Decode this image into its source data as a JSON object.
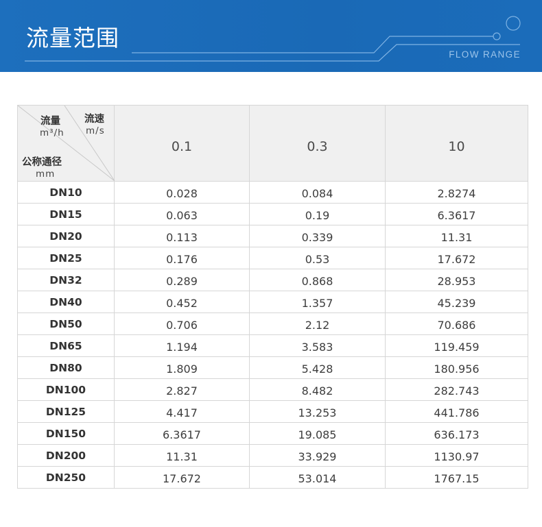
{
  "banner": {
    "title": "流量范围",
    "subtitle": "FLOW RANGE"
  },
  "table": {
    "corner": {
      "flow_label": "流量",
      "flow_unit": "m³/h",
      "velocity_label": "流速",
      "velocity_unit": "m/s",
      "diameter_label": "公称通径",
      "diameter_unit": "mm"
    },
    "velocities": [
      "0.1",
      "0.3",
      "10"
    ],
    "rows": [
      {
        "dn": "DN10",
        "values": [
          "0.028",
          "0.084",
          "2.8274"
        ]
      },
      {
        "dn": "DN15",
        "values": [
          "0.063",
          "0.19",
          "6.3617"
        ]
      },
      {
        "dn": "DN20",
        "values": [
          "0.113",
          "0.339",
          "11.31"
        ]
      },
      {
        "dn": "DN25",
        "values": [
          "0.176",
          "0.53",
          "17.672"
        ]
      },
      {
        "dn": "DN32",
        "values": [
          "0.289",
          "0.868",
          "28.953"
        ]
      },
      {
        "dn": "DN40",
        "values": [
          "0.452",
          "1.357",
          "45.239"
        ]
      },
      {
        "dn": "DN50",
        "values": [
          "0.706",
          "2.12",
          "70.686"
        ]
      },
      {
        "dn": "DN65",
        "values": [
          "1.194",
          "3.583",
          "119.459"
        ]
      },
      {
        "dn": "DN80",
        "values": [
          "1.809",
          "5.428",
          "180.956"
        ]
      },
      {
        "dn": "DN100",
        "values": [
          "2.827",
          "8.482",
          "282.743"
        ]
      },
      {
        "dn": "DN125",
        "values": [
          "4.417",
          "13.253",
          "441.786"
        ]
      },
      {
        "dn": "DN150",
        "values": [
          "6.3617",
          "19.085",
          "636.173"
        ]
      },
      {
        "dn": "DN200",
        "values": [
          "11.31",
          "33.929",
          "1130.97"
        ]
      },
      {
        "dn": "DN250",
        "values": [
          "17.672",
          "53.014",
          "1767.15"
        ]
      }
    ]
  }
}
